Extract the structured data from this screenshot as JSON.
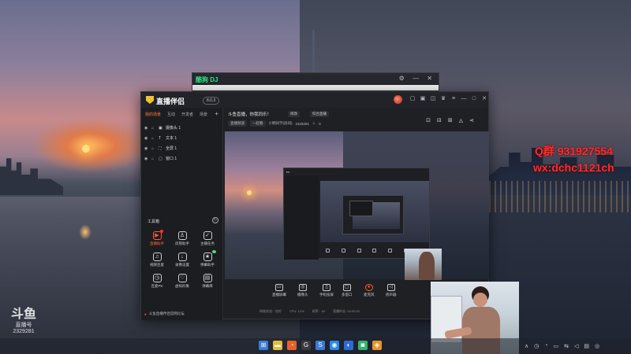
{
  "desktop": {
    "overlay_qq": "Q群 931927554",
    "overlay_wx": "wx:dchc1121ch",
    "watermark": {
      "brand": "斗鱼",
      "line2": "直播号",
      "room_id": "2329281"
    }
  },
  "dj_window": {
    "title": "酷狗 DJ"
  },
  "app": {
    "name": "直播伴侣",
    "version": "8.0.3",
    "sidebar": {
      "tabs": [
        "我的场景",
        "互动",
        "开发者",
        "场景"
      ],
      "active_tab": 0,
      "sources": [
        {
          "icon": "▣",
          "label": "摄像头 1"
        },
        {
          "icon": "T",
          "label": "文本 1"
        },
        {
          "icon": "⛶",
          "label": "全屏 1"
        },
        {
          "icon": "▢",
          "label": "窗口 1"
        }
      ],
      "tools_label": "工具箱",
      "tools": [
        {
          "icon": "▶",
          "label": "直播助手",
          "highlight": true,
          "dot": true
        },
        {
          "icon": "♙",
          "label": "房管助手"
        },
        {
          "icon": "✓",
          "label": "主播任务"
        },
        {
          "icon": "♫",
          "label": "视频连麦"
        },
        {
          "icon": "↓",
          "label": "录像设置"
        },
        {
          "icon": "★",
          "label": "弹幕助手",
          "new": true
        },
        {
          "icon": "◷",
          "label": "连麦PK"
        },
        {
          "icon": "♡",
          "label": "虚拟形象"
        },
        {
          "icon": "▤",
          "label": "弹幕库"
        }
      ],
      "footer": "斗鱼直播伴侣官网论坛"
    },
    "room": {
      "title": "斗鱼直播，你我同乐！",
      "tag1": "修改",
      "tag2": "综合直播",
      "line2": [
        "直播频道",
        "一起看",
        "小明同学(房间)",
        "2329281"
      ],
      "hot": "0"
    },
    "bottom_bar": [
      {
        "icon": "▭",
        "label": "直播屏幕"
      },
      {
        "icon": "◎",
        "label": "摄像头"
      },
      {
        "icon": "▯",
        "label": "手机投屏"
      },
      {
        "icon": "▢",
        "label": "多窗口"
      },
      {
        "icon": "●",
        "label": "麦克风",
        "mic": true
      },
      {
        "icon": "◁",
        "label": "扬声器"
      }
    ],
    "status": [
      "网络状态：良好",
      "CPU: 12%",
      "帧率：60",
      "直播时长: 00:00:00"
    ]
  },
  "taskbar": {
    "icons": [
      {
        "glyph": "⊞",
        "color": "#3a7bd5"
      },
      {
        "glyph": "▬",
        "color": "#e8b93a"
      },
      {
        "glyph": "◔",
        "color": "#e8602c"
      },
      {
        "glyph": "G",
        "color": "#3a3a3a"
      },
      {
        "glyph": "S",
        "color": "#3a7bd5"
      },
      {
        "glyph": "◉",
        "color": "#2a88e8"
      },
      {
        "glyph": "◐",
        "color": "#2a6bd8"
      },
      {
        "glyph": "◙",
        "color": "#34b36e"
      },
      {
        "glyph": "◈",
        "color": "#e8962c"
      }
    ],
    "tray": [
      "∧",
      "◷",
      "◔",
      "▭",
      "⇆",
      "◁",
      "▤",
      "◎"
    ]
  }
}
